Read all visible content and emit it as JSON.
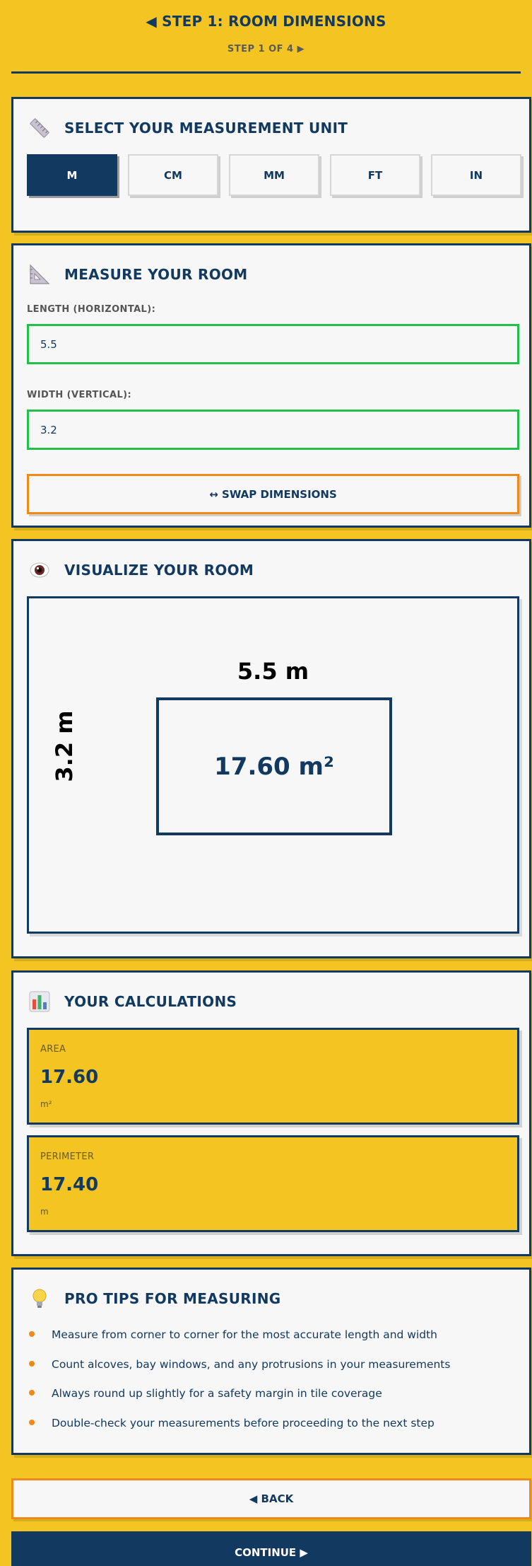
{
  "header": {
    "title": "◀ STEP 1: ROOM DIMENSIONS",
    "step_indicator": "STEP 1 OF 4 ▶"
  },
  "unit_section": {
    "title": "SELECT YOUR MEASUREMENT UNIT",
    "icon": "ruler-icon",
    "units": [
      "M",
      "CM",
      "MM",
      "FT",
      "IN"
    ],
    "selected": "M"
  },
  "measure_section": {
    "title": "MEASURE YOUR ROOM",
    "icon": "triangle-ruler-icon",
    "length_label": "LENGTH (HORIZONTAL):",
    "length_value": "5.5",
    "width_label": "WIDTH (VERTICAL):",
    "width_value": "3.2",
    "swap_label": "↔ SWAP DIMENSIONS"
  },
  "visualize_section": {
    "title": "VISUALIZE YOUR ROOM",
    "icon": "eye-icon",
    "length_text": "5.5 m",
    "width_text": "3.2 m",
    "area_text": "17.60 m²"
  },
  "calculations_section": {
    "title": "YOUR CALCULATIONS",
    "icon": "bar-chart-icon",
    "area": {
      "label": "AREA",
      "value": "17.60",
      "unit": "m²"
    },
    "perimeter": {
      "label": "PERIMETER",
      "value": "17.40",
      "unit": "m"
    }
  },
  "tips_section": {
    "title": "PRO TIPS FOR MEASURING",
    "icon": "lightbulb-icon",
    "tips": [
      "Measure from corner to corner for the most accurate length and width",
      "Count alcoves, bay windows, and any protrusions in your measurements",
      "Always round up slightly for a safety margin in tile coverage",
      "Double-check your measurements before proceeding to the next step"
    ]
  },
  "nav": {
    "back_label": "◀ BACK",
    "continue_label": "CONTINUE ▶"
  },
  "colors": {
    "background": "#f4c522",
    "primary": "#123a60",
    "valid": "#22c04a",
    "accent": "#ef8a1a"
  }
}
